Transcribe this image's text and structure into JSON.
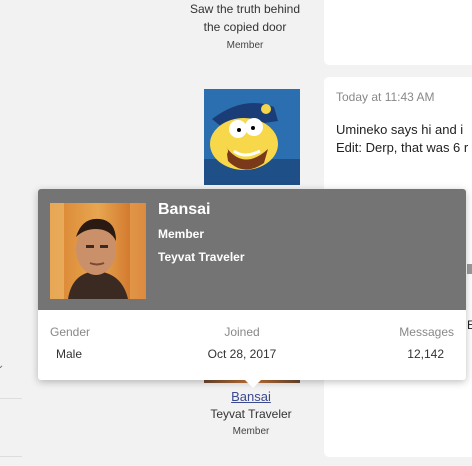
{
  "top_user": {
    "title_line1": "Saw the truth behind",
    "title_line2": "the copied door",
    "role": "Member"
  },
  "post": {
    "time": "Today at 11:43 AM",
    "line1": "Umineko says hi and i",
    "line2": "Edit: Derp, that was 6 r"
  },
  "bottom_user": {
    "name": "Bansai",
    "title": "Teyvat Traveler",
    "role": "Member"
  },
  "tooltip": {
    "name": "Bansai",
    "role": "Member",
    "title": "Teyvat Traveler",
    "stats": {
      "gender_label": "Gender",
      "gender_value": "Male",
      "joined_label": "Joined",
      "joined_value": "Oct 28, 2017",
      "messages_label": "Messages",
      "messages_value": "12,142"
    }
  },
  "right_edge_letter": "E",
  "colors": {
    "header_bg": "#747474",
    "link": "#3b4a8f",
    "page_bg": "#f2f2f2"
  }
}
